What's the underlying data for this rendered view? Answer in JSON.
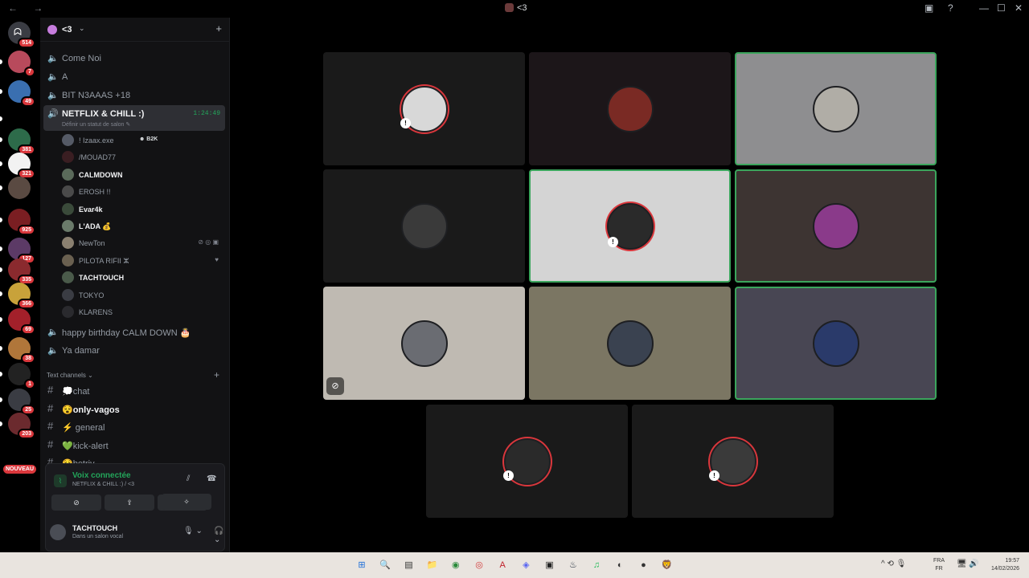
{
  "titlebar": {
    "title": "<3",
    "nav": "← →",
    "min": "—",
    "max": "☐",
    "close": "✕",
    "help": "?",
    "inbox": "▣"
  },
  "rail": {
    "top_badge": "514",
    "servers": [
      {
        "badge": "7",
        "color": "#b84a5c"
      },
      {
        "badge": "49",
        "color": "#3a6fb0"
      },
      {
        "badge": "",
        "color": "#000000"
      },
      {
        "badge": "381",
        "color": "#2d6b4a"
      },
      {
        "badge": "321",
        "color": "#f2f2f2"
      },
      {
        "badge": "",
        "color": "#5a4a42"
      },
      {
        "badge": "925",
        "color": "#7a1e22"
      },
      {
        "badge": "127",
        "color": "#5c3a66"
      },
      {
        "badge": "335",
        "color": "#8a2a2e"
      },
      {
        "badge": "366",
        "color": "#c8a23a"
      },
      {
        "badge": "69",
        "color": "#a3202a"
      },
      {
        "badge": "38",
        "color": "#b0763a"
      },
      {
        "badge": "1",
        "color": "#222222"
      },
      {
        "badge": "25",
        "color": "#3a3c43"
      },
      {
        "badge": "203",
        "color": "#6b2a2e"
      }
    ],
    "new_badge": "NOUVEAU"
  },
  "guild": {
    "name": "<3",
    "invite_icon": "+"
  },
  "voice_channels": [
    {
      "label": "Come Noi"
    },
    {
      "label": "A"
    },
    {
      "label": "BIT N3AAAS +18"
    }
  ],
  "active_channel": {
    "label": "NETFLIX & CHILL :)",
    "timer": "1:24:49",
    "status": "Définir un statut de salon ✎"
  },
  "members": [
    {
      "name": "! Izaax.exe",
      "tag": "☻ B2K",
      "strong": false,
      "color": "#555a66"
    },
    {
      "name": "/MOUAD77",
      "tag": "",
      "strong": false,
      "color": "#3a1e22"
    },
    {
      "name": "CALMDOWN",
      "tag": "",
      "strong": true,
      "color": "#5a6a5a"
    },
    {
      "name": "EROSH !!",
      "tag": "",
      "strong": false,
      "color": "#4a4a4a"
    },
    {
      "name": "Evar4k",
      "tag": "",
      "strong": true,
      "color": "#3a4a3a"
    },
    {
      "name": "L'ADA 💰",
      "tag": "",
      "strong": true,
      "color": "#6a7a6a"
    },
    {
      "name": "NewTon",
      "tag": "",
      "strong": false,
      "color": "#8a8070",
      "icons": "⊘ ◎ ▣"
    },
    {
      "name": "PILOTA RIFII ⵣ",
      "tag": "",
      "strong": false,
      "color": "#6a6050",
      "icons": "♥"
    },
    {
      "name": "TACHTOUCH",
      "tag": "",
      "strong": true,
      "color": "#4a5a4a"
    },
    {
      "name": "TOKYO",
      "tag": "",
      "strong": false,
      "color": "#3a3c43"
    },
    {
      "name": "KLARENS",
      "tag": "",
      "strong": false,
      "color": "#2a2a2e"
    }
  ],
  "more_voice": [
    {
      "label": "happy birthday CALM DOWN 🎂"
    },
    {
      "label": "Ya damar"
    }
  ],
  "text_category": {
    "label": "Text channels ⌄",
    "plus": "+"
  },
  "text_channels": [
    {
      "label": "💭chat",
      "bold": false
    },
    {
      "label": "😵only-vagos",
      "bold": true
    },
    {
      "label": "⚡ general",
      "bold": false
    },
    {
      "label": "💚kick-alert",
      "bold": false
    },
    {
      "label": "😵betriv",
      "bold": false
    }
  ],
  "voice_panel": {
    "title": "Voix connectée",
    "subtitle": "NETFLIX & CHILL :) / <3",
    "buttons": [
      "⊘",
      "⇪",
      "✦",
      "✧"
    ]
  },
  "user_panel": {
    "name": "TACHTOUCH",
    "status": "Dans un salon vocal",
    "mic": "🎙 ⌄",
    "headset": "🎧 ⌄",
    "settings": "⚙"
  },
  "tiles": [
    {
      "bg": "#1a1a1a",
      "avatar": "#d8d8d8",
      "speaking": false,
      "ring": true,
      "mark": true
    },
    {
      "bg": "#1c1619",
      "avatar": "#7a2a24",
      "speaking": false,
      "ring": false,
      "mark": false
    },
    {
      "bg": "#8e8e90",
      "avatar": "#b0ada6",
      "speaking": true,
      "ring": false,
      "mark": false
    },
    {
      "bg": "#1a1a1a",
      "avatar": "#3a3a3a",
      "speaking": false,
      "ring": false,
      "mark": false
    },
    {
      "bg": "#d4d4d4",
      "avatar": "#2a2a2a",
      "speaking": true,
      "ring": true,
      "mark": true
    },
    {
      "bg": "#3d3432",
      "avatar": "#8a3a8a",
      "speaking": true,
      "ring": false,
      "mark": false
    },
    {
      "bg": "#bfbab2",
      "avatar": "#6a6c72",
      "speaking": false,
      "ring": false,
      "mark": false,
      "camoff": "⊘"
    },
    {
      "bg": "#7b7663",
      "avatar": "#3a4250",
      "speaking": false,
      "ring": false,
      "mark": false
    },
    {
      "bg": "#484653",
      "avatar": "#2a3a6a",
      "speaking": true,
      "ring": false,
      "mark": false
    },
    {
      "bg": "#1a1a1a",
      "avatar": "#2a2a2a",
      "speaking": false,
      "ring": true,
      "mark": true
    },
    {
      "bg": "#1a1a1a",
      "avatar": "#3a3a3a",
      "speaking": false,
      "ring": true,
      "mark": true
    }
  ],
  "taskbar": {
    "apps": [
      "⊞",
      "🔍",
      "▤",
      "📁",
      "◉",
      "◎",
      "A",
      "◈",
      "▣",
      "♨",
      "♫",
      "◐",
      "●",
      "🦁"
    ],
    "tray": "^ ⟲ 🎙",
    "lang_top": "FRA",
    "lang_bottom": "FR",
    "time": "19:57",
    "date": "14/02/2026"
  }
}
